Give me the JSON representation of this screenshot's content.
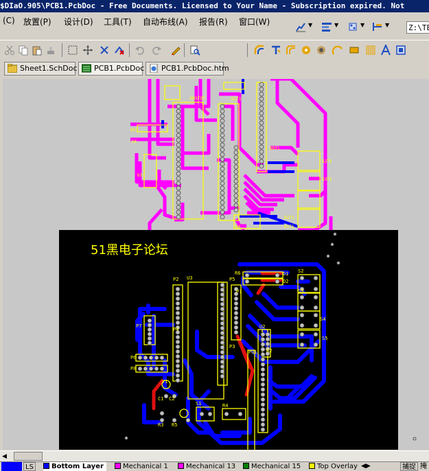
{
  "window": {
    "title": "$DIaO.905\\PCB1.PcbDoc - Free Documents. Licensed to Your Name - Subscription expired. Not"
  },
  "menu": {
    "items": [
      "(C)",
      "放置(P)",
      "设计(D)",
      "工具(T)",
      "自动布线(A)",
      "报告(R)",
      "窗口(W)"
    ]
  },
  "path_box": {
    "value": "Z:\\TE"
  },
  "tabs": [
    {
      "label": "Sheet1.SchDoc",
      "icon": "schematic-doc-icon"
    },
    {
      "label": "PCB1.PcbDoc",
      "icon": "pcb-doc-icon"
    },
    {
      "label": "PCB1.PcbDoc.htm",
      "icon": "html-doc-icon"
    }
  ],
  "pcb": {
    "watermark": "51黑电子论坛",
    "designators": {
      "P2": "P2",
      "U3": "U3",
      "P5": "P5",
      "R6": "R6",
      "D1": "D1",
      "D2": "D2",
      "S2": "S2",
      "S3": "S3",
      "S4": "S4",
      "S5": "S5",
      "P7": "P7",
      "P1": "P1",
      "P4": "P4",
      "U2": "U2",
      "R2": "R2",
      "P3": "P3",
      "PU1": "PU1",
      "P6": "P6",
      "P8": "P8",
      "Y1": "Y1",
      "S1": "S1",
      "R4": "R4",
      "R3": "R3",
      "R5": "R5",
      "C1": "C1",
      "C2": "C2"
    }
  },
  "layers": [
    {
      "label": "LS",
      "color": "#0000ff"
    },
    {
      "label": "Bottom Layer",
      "color": "#0000ff"
    },
    {
      "label": "Mechanical 1",
      "color": "#ff00ff"
    },
    {
      "label": "Mechanical 13",
      "color": "#ff00ff"
    },
    {
      "label": "Mechanical 15",
      "color": "#008000"
    },
    {
      "label": "Top Overlay",
      "color": "#ffff00"
    }
  ],
  "status": {
    "snap": "捕捉",
    "mask": "掩"
  },
  "colors": {
    "titlebar": "#0a246a",
    "top_layer": "#ff00ff",
    "bottom_layer": "#0000ff",
    "overlay": "#ffff00",
    "board_bg": "#000000",
    "workspace_bg": "#c8c8c8"
  }
}
